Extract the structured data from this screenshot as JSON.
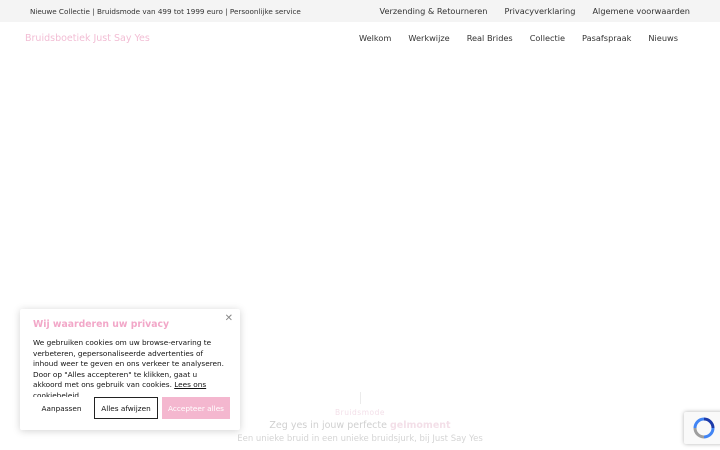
{
  "topbar": {
    "notice": "Nieuwe Collectie | Bruidsmode van 499 tot 1999 euro | Persoonlijke service",
    "links": [
      "Verzending & Retourneren",
      "Privacyverklaring",
      "Algemene voorwaarden"
    ]
  },
  "header": {
    "logo": "Bruidsboetiek Just Say Yes",
    "nav": [
      "Welkom",
      "Werkwijze",
      "Real Brides",
      "Collectie",
      "Pasafspraak",
      "Nieuws"
    ]
  },
  "hero": {
    "eyebrow": "Bruidsmode",
    "headline_prefix": "Zeg yes in jouw perfecte ",
    "headline_emphasis": "gelmoment",
    "subline": "Een unieke bruid in een unieke bruidsjurk, bij Just Say Yes"
  },
  "cookie_banner": {
    "title": "Wij waarderen uw privacy",
    "body": "We gebruiken cookies om uw browse-ervaring te verbeteren, gepersonaliseerde advertenties of inhoud weer te geven en ons verkeer te analyseren. Door op \"Alles accepteren\" te klikken, gaat u akkoord met ons gebruik van cookies.",
    "policy_link": "Lees ons cookiebeleid",
    "customize_label": "Aanpassen",
    "reject_label": "Alles afwijzen",
    "accept_label": "Accepteer alles",
    "close_icon": "close-icon"
  },
  "colors": {
    "accent_pink": "#f2a7c8",
    "button_pink": "#f4b7cf",
    "topbar_bg": "#f4f4f4"
  }
}
